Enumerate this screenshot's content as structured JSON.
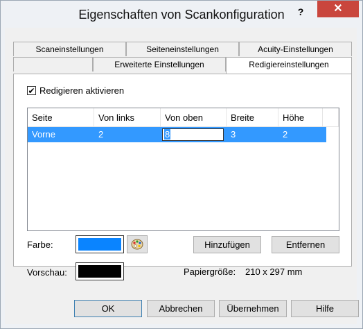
{
  "window": {
    "title": "Eigenschaften von Scankonfiguration",
    "help_label": "?",
    "close_label": "✕"
  },
  "tabs": {
    "row1": [
      "Scaneinstellungen",
      "Seiteneinstellungen",
      "Acuity-Einstellungen"
    ],
    "row2": [
      "",
      "Erweiterte Einstellungen",
      "Redigiereinstellungen"
    ],
    "active": "Redigiereinstellungen"
  },
  "redact": {
    "enable_label": "Redigieren aktivieren",
    "enabled": true,
    "columns": [
      "Seite",
      "Von links",
      "Von oben",
      "Breite",
      "Höhe"
    ],
    "rows": [
      {
        "seite": "Vorne",
        "von_links": "2",
        "von_oben": "8",
        "breite": "3",
        "hoehe": "2"
      }
    ]
  },
  "color": {
    "label": "Farbe:",
    "value": "#0a84ff"
  },
  "preview": {
    "label": "Vorschau:",
    "value": "#000000"
  },
  "buttons": {
    "add": "Hinzufügen",
    "remove": "Entfernen",
    "ok": "OK",
    "cancel": "Abbrechen",
    "apply": "Übernehmen",
    "help": "Hilfe"
  },
  "paper": {
    "label": "Papiergröße:",
    "value": "210 x 297 mm"
  },
  "icons": {
    "palette": "palette-icon",
    "check": "checkmark-icon"
  }
}
